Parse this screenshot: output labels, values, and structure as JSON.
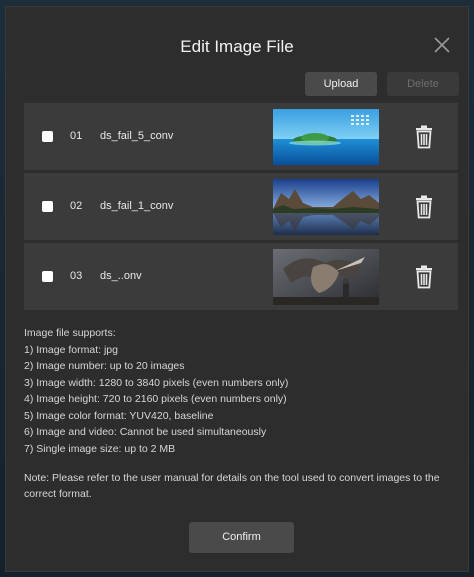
{
  "dialog": {
    "title": "Edit Image File",
    "close_icon": "close-icon"
  },
  "toolbar": {
    "upload_label": "Upload",
    "delete_label": "Delete",
    "delete_enabled": false
  },
  "files": [
    {
      "index": "01",
      "name": "ds_fail_5_conv",
      "checked": false,
      "thumbnail": "island-seascape"
    },
    {
      "index": "02",
      "name": "ds_fail_1_conv",
      "checked": false,
      "thumbnail": "valley-lake"
    },
    {
      "index": "03",
      "name": "ds_..onv",
      "checked": false,
      "thumbnail": "monster-battle"
    }
  ],
  "info": {
    "heading": "Image file supports:",
    "lines": [
      "1) Image format: jpg",
      "2) Image number: up to 20 images",
      "3) Image width: 1280 to 3840 pixels (even numbers only)",
      "4) Image height: 720 to 2160 pixels (even numbers only)",
      "5) Image color format: YUV420, baseline",
      "6) Image and video: Cannot be used simultaneously",
      "7) Single image size: up to 2 MB"
    ],
    "note": "Note: Please refer to the user manual for details on the tool used to convert images to the correct format."
  },
  "footer": {
    "confirm_label": "Confirm"
  },
  "colors": {
    "dialog_bg": "#2d2d2d",
    "row_bg": "#3b3b3b",
    "button_bg": "#4a4a4a",
    "disabled_text": "#6e6e6e"
  }
}
